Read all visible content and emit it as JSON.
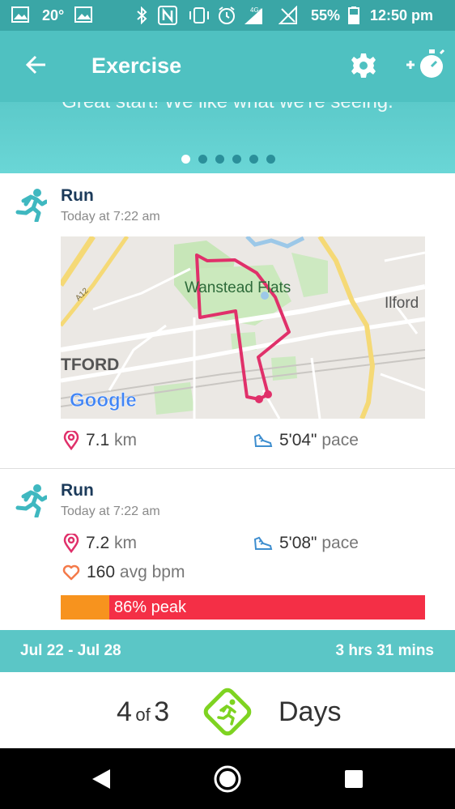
{
  "status": {
    "temperature": "20°",
    "battery": "55%",
    "time": "12:50 pm",
    "network": "4G+"
  },
  "header": {
    "title": "Exercise",
    "back_icon": "arrow-left-icon",
    "settings_icon": "gear-icon",
    "add_icon": "add-stopwatch-icon"
  },
  "hero": {
    "message": "Great start! We like what we're seeing.",
    "page_count": 6,
    "active_page": 1
  },
  "activities": [
    {
      "title": "Run",
      "time": "Today at 7:22 am",
      "distance_value": "7.1",
      "distance_unit": "km",
      "pace_value": "5'04\"",
      "pace_unit": "pace",
      "map": {
        "labels": [
          "Wanstead Flats",
          "Ilford",
          "TFORD",
          "A12"
        ],
        "logo": "Google"
      }
    },
    {
      "title": "Run",
      "time": "Today at 7:22 am",
      "distance_value": "7.2",
      "distance_unit": "km",
      "pace_value": "5'08\"",
      "pace_unit": "pace",
      "hr_value": "160",
      "hr_unit": "avg bpm",
      "peak_label": "86% peak"
    }
  ],
  "week": {
    "range": "Jul 22 - Jul 28",
    "total": "3 hrs 31 mins"
  },
  "goal": {
    "count": "4",
    "of": "of",
    "target": "3",
    "label": "Days"
  },
  "colors": {
    "teal": "#4fc1c1",
    "route": "#e0306a",
    "peak": "#f42f46",
    "fat_burn": "#f7931e",
    "goal_green": "#7ed321"
  }
}
